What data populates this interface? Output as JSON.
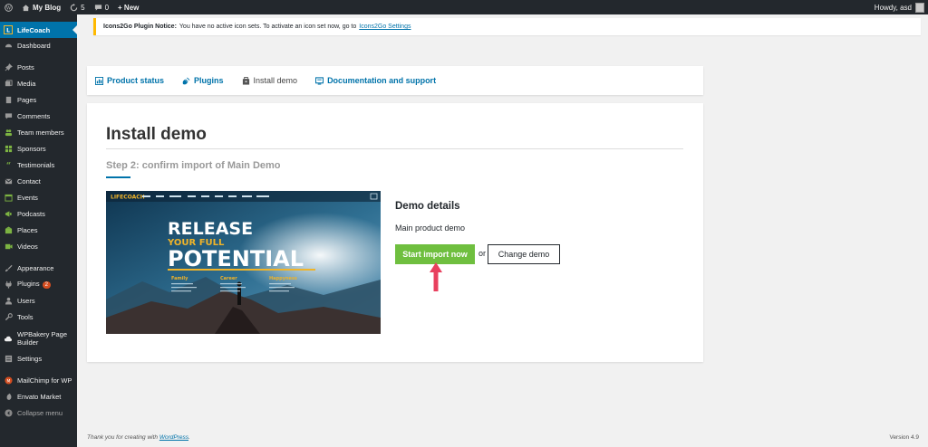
{
  "adminbar": {
    "site_name": "My Blog",
    "updates_count": "5",
    "comments_count": "0",
    "new_label": "+ New",
    "howdy": "Howdy, asd"
  },
  "sidebar": {
    "items": [
      {
        "label": "LifeCoach",
        "icon": "lifecoach-logo-icon",
        "active": true
      },
      {
        "label": "Dashboard",
        "icon": "dashboard-icon"
      },
      {
        "label": "Posts",
        "icon": "pin-icon"
      },
      {
        "label": "Media",
        "icon": "media-icon"
      },
      {
        "label": "Pages",
        "icon": "pages-icon"
      },
      {
        "label": "Comments",
        "icon": "comment-icon"
      },
      {
        "label": "Team members",
        "icon": "team-icon"
      },
      {
        "label": "Sponsors",
        "icon": "sponsors-icon"
      },
      {
        "label": "Testimonials",
        "icon": "quote-icon"
      },
      {
        "label": "Contact",
        "icon": "mail-icon"
      },
      {
        "label": "Events",
        "icon": "calendar-icon"
      },
      {
        "label": "Podcasts",
        "icon": "megaphone-icon"
      },
      {
        "label": "Places",
        "icon": "places-icon"
      },
      {
        "label": "Videos",
        "icon": "video-icon"
      },
      {
        "label": "Appearance",
        "icon": "brush-icon"
      },
      {
        "label": "Plugins",
        "icon": "plugin-icon",
        "badge": "2"
      },
      {
        "label": "Users",
        "icon": "user-icon"
      },
      {
        "label": "Tools",
        "icon": "wrench-icon"
      },
      {
        "label": "WPBakery Page Builder",
        "icon": "cloud-icon"
      },
      {
        "label": "Settings",
        "icon": "settings-icon"
      },
      {
        "label": "MailChimp for WP",
        "icon": "mailchimp-icon"
      },
      {
        "label": "Envato Market",
        "icon": "envato-icon"
      },
      {
        "label": "Collapse menu",
        "icon": "collapse-icon"
      }
    ]
  },
  "notice": {
    "title": "Icons2Go Plugin Notice:",
    "text": "You have no active icon sets. To activate an icon set now, go to",
    "link": "Icons2Go Settings"
  },
  "tabs": [
    {
      "label": "Product status",
      "icon": "product-status-icon"
    },
    {
      "label": "Plugins",
      "icon": "plugin-icon"
    },
    {
      "label": "Install demo",
      "icon": "install-icon",
      "current": true
    },
    {
      "label": "Documentation and support",
      "icon": "documentation-icon"
    }
  ],
  "main": {
    "title": "Install demo",
    "step": "Step 2: confirm import of Main Demo",
    "preview": {
      "brand": "LIFECOACH",
      "headline_1": "RELEASE",
      "headline_2": "YOUR FULL",
      "headline_3": "POTENTIAL",
      "columns": [
        "Family",
        "Career",
        "Happyness"
      ]
    },
    "details_title": "Demo details",
    "details_desc": "Main product demo",
    "import_button": "Start import now",
    "or_text": "or",
    "change_button": "Change demo"
  },
  "footer": {
    "thanks_prefix": "Thank you for creating with",
    "thanks_link": "WordPress",
    "thanks_suffix": ".",
    "version": "Version 4.9"
  },
  "colors": {
    "accent": "#0073aa",
    "import_button": "#6fbf3f",
    "arrow": "#e8405e",
    "notice_border": "#ffb900"
  }
}
